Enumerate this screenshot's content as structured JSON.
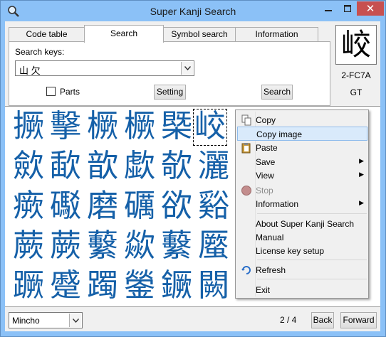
{
  "window": {
    "title": "Super Kanji Search",
    "close_glyph": "✕"
  },
  "tabs": [
    {
      "label": "Code table"
    },
    {
      "label": "Search"
    },
    {
      "label": "Symbol search"
    },
    {
      "label": "Information"
    }
  ],
  "search": {
    "keys_label": "Search keys:",
    "keys_value": "山 欠",
    "parts_label": "Parts",
    "parts_checked": false,
    "setting_label": "Setting",
    "search_label": "Search"
  },
  "preview": {
    "kanji": "峧",
    "code": "2-FC7A",
    "grade": "GT"
  },
  "results": [
    [
      "撅",
      "擊",
      "橛",
      "橛",
      "槩",
      "峧"
    ],
    [
      "歛",
      "歃",
      "歆",
      "歔",
      "欹",
      "灑"
    ],
    [
      "瘚",
      "礟",
      "磨",
      "礪",
      "欲",
      "谿"
    ],
    [
      "蕨",
      "蕨",
      "蘻",
      "歘",
      "蘻",
      "蟨"
    ],
    [
      "蹶",
      "蹙",
      "躅",
      "鎣",
      "鐝",
      "闕"
    ]
  ],
  "context_menu": {
    "copy": "Copy",
    "copy_image": "Copy image",
    "paste": "Paste",
    "save": "Save",
    "view": "View",
    "stop": "Stop",
    "information": "Information",
    "about": "About Super Kanji Search",
    "manual": "Manual",
    "license": "License key setup",
    "refresh": "Refresh",
    "exit": "Exit"
  },
  "footer": {
    "font": "Mincho",
    "page": "2 / 4",
    "back": "Back",
    "forward": "Forward"
  },
  "colors": {
    "kanji_blue": "#1560a8",
    "titlebar": "#8bc1f7",
    "close_red": "#c75050",
    "menu_highlight": "#d9eafb"
  }
}
